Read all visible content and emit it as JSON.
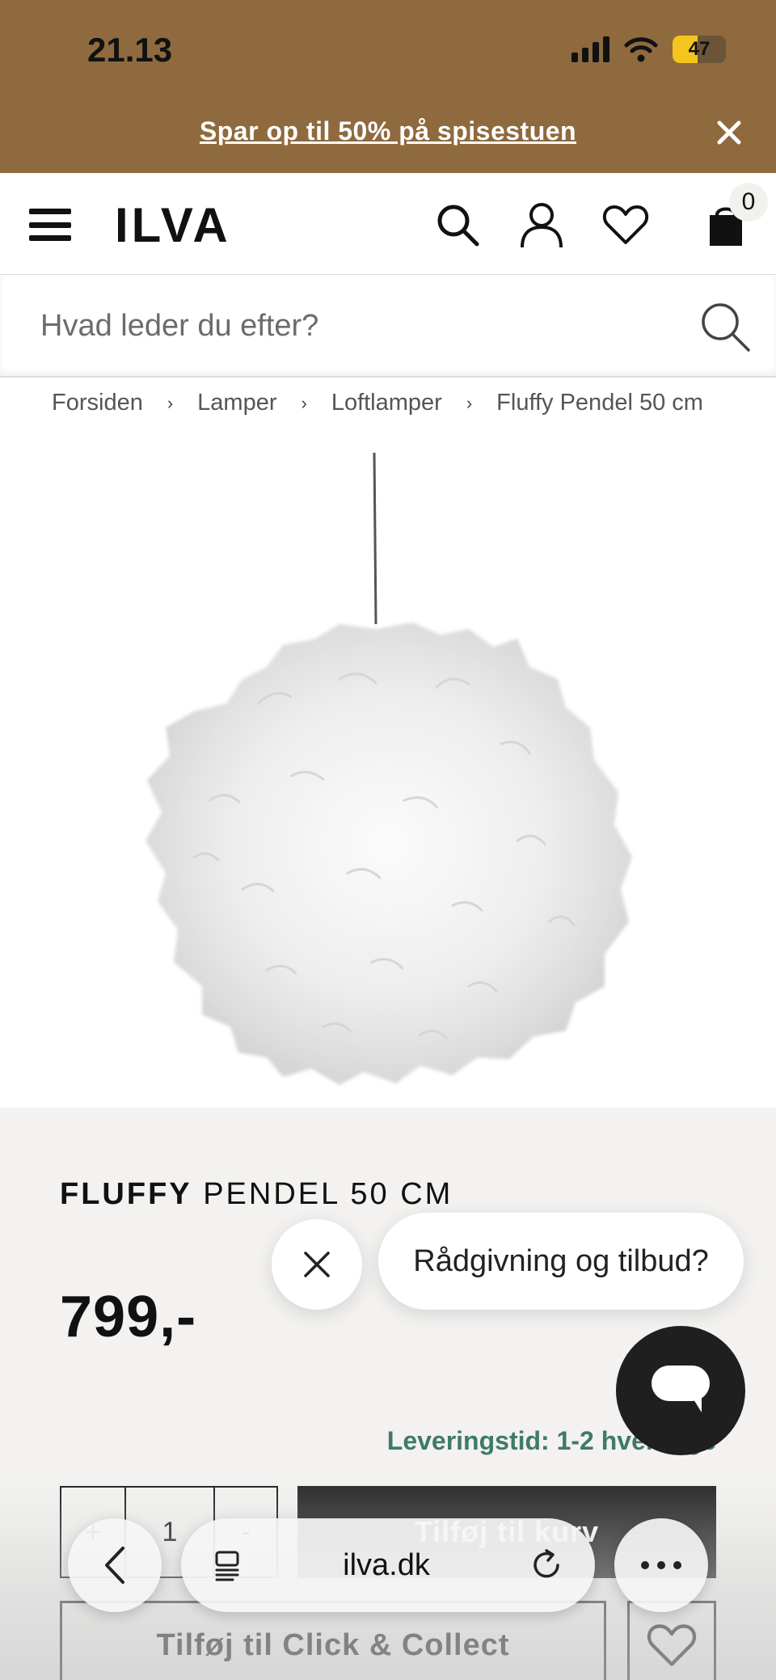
{
  "status_bar": {
    "time": "21.13",
    "battery": "47",
    "battery_level": 0.47
  },
  "promo": {
    "text": "Spar op til 50% på spisestuen"
  },
  "header": {
    "logo": "ILVA",
    "cart_count": "0"
  },
  "search": {
    "placeholder": "Hvad leder du efter?"
  },
  "breadcrumb": [
    "Forsiden",
    "Lamper",
    "Loftlamper",
    "Fluffy Pendel 50 cm"
  ],
  "product": {
    "title_bold": "FLUFFY",
    "title_rest": " PENDEL 50 CM",
    "price": "799,-",
    "delivery": "Leveringstid: 1-2 hverdage",
    "quantity": "1",
    "qty_minus": "-",
    "qty_plus": "+",
    "buy_label": "Tilføj til kurv",
    "click_collect_label": "Tilføj til Click & Collect"
  },
  "chat": {
    "prompt": "Rådgivning og tilbud?"
  },
  "browser": {
    "url": "ilva.dk"
  },
  "colors": {
    "promo_bg": "#8e6a3e",
    "delivery": "#3f7a6a",
    "buy_bg": "#2b2b2b",
    "panel_bg": "#f3f2f0"
  }
}
